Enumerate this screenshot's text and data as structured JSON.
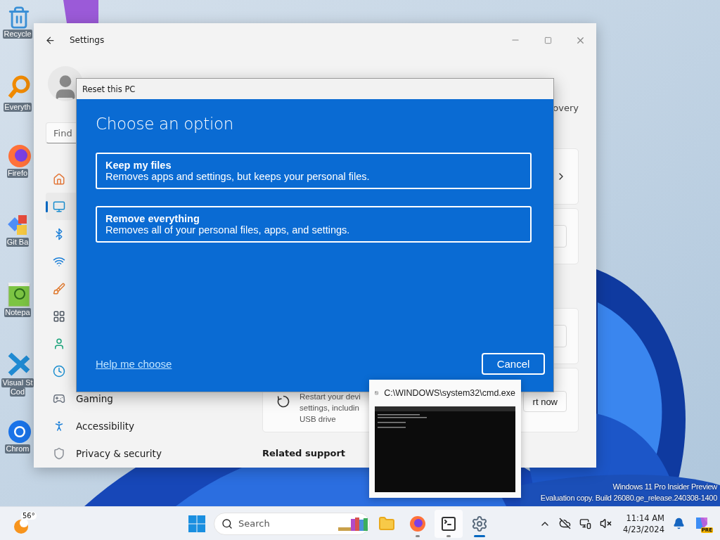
{
  "desktop": {
    "icons": [
      {
        "kind": "recycle",
        "lines": [
          "Recycle"
        ]
      },
      {
        "kind": "everything",
        "lines": [
          "Everyth"
        ]
      },
      {
        "kind": "firefox",
        "lines": [
          "Firefo"
        ]
      },
      {
        "kind": "git",
        "lines": [
          "Git Ba"
        ]
      },
      {
        "kind": "notepad",
        "lines": [
          "Notepa"
        ]
      },
      {
        "kind": "vscode",
        "lines": [
          "Visual St",
          "Cod"
        ]
      },
      {
        "kind": "chrome",
        "lines": [
          "Chrom"
        ]
      }
    ],
    "watermark": [
      "Windows 11 Pro Insider Preview",
      "Evaluation copy. Build 26080.ge_release.240308-1400"
    ]
  },
  "settings": {
    "title": "Settings",
    "search": {
      "placeholder": "Find"
    },
    "nav": [
      {
        "kind": "home",
        "selected": false
      },
      {
        "kind": "system",
        "selected": true
      },
      {
        "kind": "bluetooth",
        "selected": false
      },
      {
        "kind": "network",
        "selected": false
      },
      {
        "kind": "personalization",
        "selected": false
      },
      {
        "kind": "apps",
        "selected": false
      },
      {
        "kind": "accounts",
        "selected": false
      },
      {
        "kind": "time",
        "selected": false
      },
      {
        "kind": "gaming",
        "label": "Gaming",
        "selected": false
      },
      {
        "kind": "accessibility",
        "label": "Accessibility",
        "selected": false
      },
      {
        "kind": "privacy",
        "label": "Privacy & security",
        "selected": false
      }
    ],
    "subtitle": "overy",
    "cards": [
      {
        "kind": "chevron"
      },
      {
        "kind": "button"
      },
      {
        "kind": "button"
      },
      {
        "kind": "restart",
        "lines": [
          "Restart your devi",
          "settings, includin",
          "USB drive"
        ],
        "button": "rt now"
      }
    ],
    "related": "Related support"
  },
  "dialog": {
    "title": "Reset this PC",
    "heading": "Choose an option",
    "options": [
      {
        "title": "Keep my files",
        "description": "Removes apps and settings, but keeps your personal files."
      },
      {
        "title": "Remove everything",
        "description": "Removes all of your personal files, apps, and settings."
      }
    ],
    "help_link": "Help me choose",
    "cancel": "Cancel"
  },
  "preview": {
    "title": "C:\\WINDOWS\\system32\\cmd.exe"
  },
  "taskbar": {
    "weather": "56°",
    "search": {
      "placeholder": "Search"
    },
    "apps": [
      {
        "kind": "explorer",
        "running": false,
        "hovered": false,
        "selected": false
      },
      {
        "kind": "firefox",
        "running": true,
        "hovered": false,
        "selected": false
      },
      {
        "kind": "terminal",
        "running": true,
        "hovered": true,
        "selected": false
      },
      {
        "kind": "settings",
        "running": true,
        "hovered": false,
        "selected": true
      }
    ],
    "tray": [
      {
        "kind": "chevron"
      },
      {
        "kind": "cloud-off"
      },
      {
        "kind": "network"
      },
      {
        "kind": "volume-muted"
      }
    ],
    "time": "11:14 AM",
    "date": "4/23/2024",
    "copilot_badge": "PRE"
  }
}
